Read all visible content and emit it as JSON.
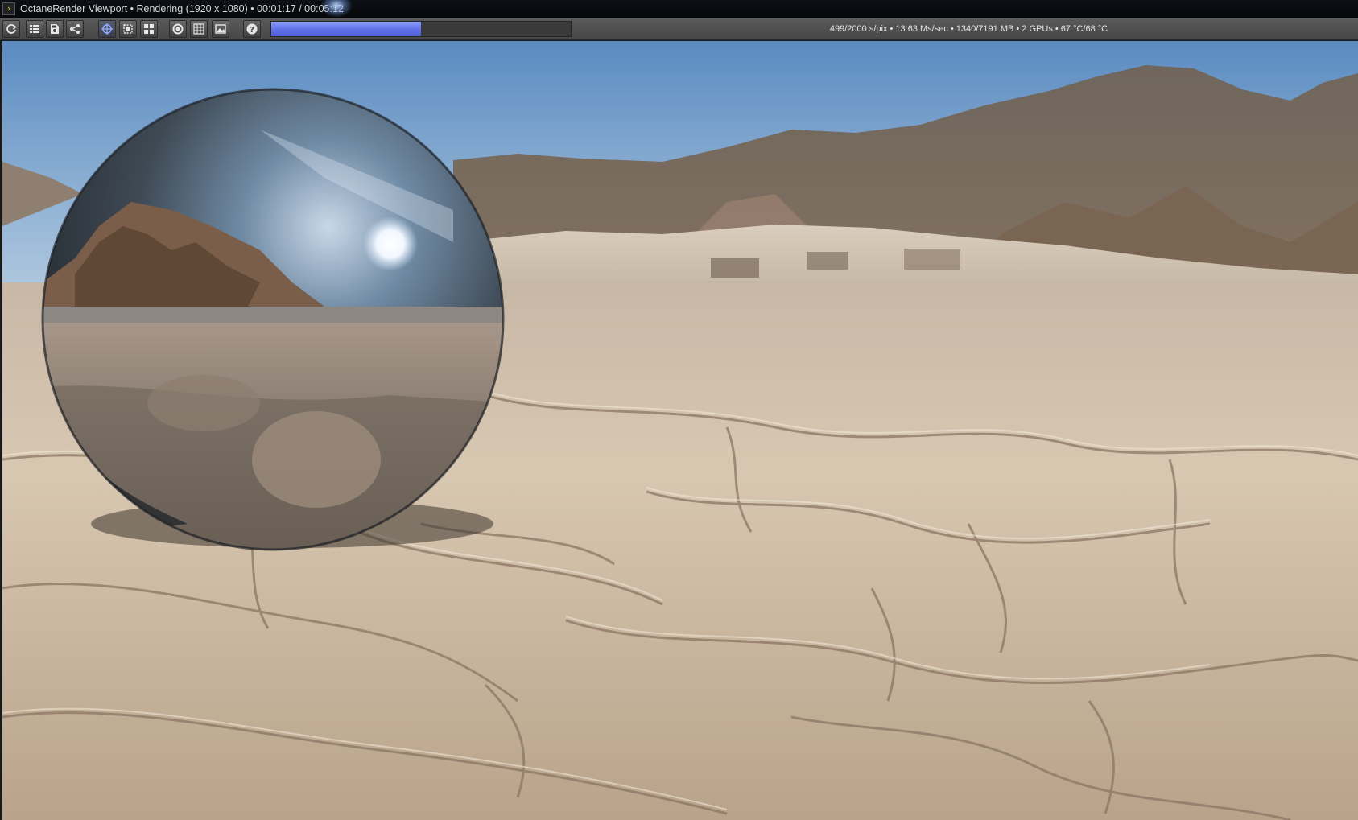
{
  "window": {
    "title": "OctaneRender Viewport • Rendering (1920 x 1080) • 00:01:17 / 00:05:12",
    "icon": "octane-app-icon"
  },
  "toolbar": {
    "buttons": [
      {
        "name": "restart-render-button",
        "icon": "refresh-icon"
      },
      {
        "name": "render-passes-button",
        "icon": "layers-icon"
      },
      {
        "name": "save-render-button",
        "icon": "save-icon"
      },
      {
        "name": "share-button",
        "icon": "share-icon"
      },
      {
        "name": "focus-picker-button",
        "icon": "crosshair-icon",
        "active": true
      },
      {
        "name": "region-render-button",
        "icon": "region-icon"
      },
      {
        "name": "viewport-layout-button",
        "icon": "grid-icon"
      },
      {
        "name": "lock-viewport-button",
        "icon": "circle-icon"
      },
      {
        "name": "film-region-button",
        "icon": "table-icon"
      },
      {
        "name": "background-image-button",
        "icon": "image-icon"
      },
      {
        "name": "help-button",
        "icon": "help-icon"
      }
    ],
    "progress": 0.4988,
    "progress_color": "#6a7bf0",
    "stats": "499/2000 s/pix • 13.63 Ms/sec • 1340/7191 MB • 2 GPUs • 67 °C/68 °C"
  },
  "viewport": {
    "scene": "render-output"
  },
  "colors": {
    "toolbar": "#4f4f4f",
    "titlebar": "#080a0e",
    "sky_top": "#5b8bc1",
    "ground": "#cdb9a0"
  }
}
